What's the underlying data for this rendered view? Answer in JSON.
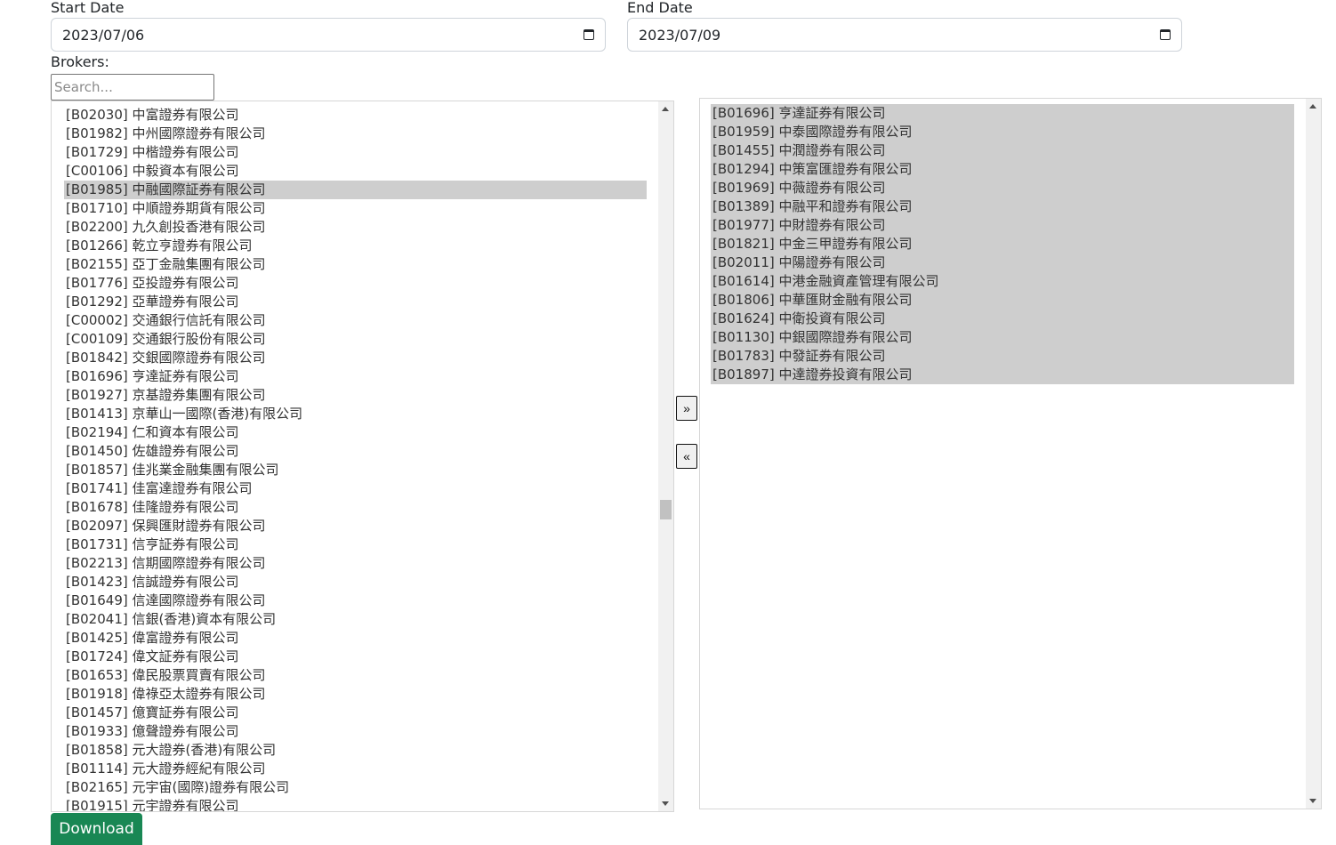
{
  "form": {
    "start_date_label": "Start Date",
    "start_date_value": "2023/07/06",
    "end_date_label": "End Date",
    "end_date_value": "2023/07/09",
    "brokers_label": "Brokers:",
    "search_placeholder": "Search..."
  },
  "available_brokers": [
    {
      "label": "[B02030] 中富證券有限公司",
      "selected": false
    },
    {
      "label": "[B01982] 中州國際證券有限公司",
      "selected": false
    },
    {
      "label": "[B01729] 中楷證券有限公司",
      "selected": false
    },
    {
      "label": "[C00106] 中毅資本有限公司",
      "selected": false
    },
    {
      "label": "[B01985] 中融國際証券有限公司",
      "selected": true
    },
    {
      "label": "[B01710] 中順證券期貨有限公司",
      "selected": false
    },
    {
      "label": "[B02200] 九久創投香港有限公司",
      "selected": false
    },
    {
      "label": "[B01266] 乾立亨證券有限公司",
      "selected": false
    },
    {
      "label": "[B02155] 亞丁金融集團有限公司",
      "selected": false
    },
    {
      "label": "[B01776] 亞投證券有限公司",
      "selected": false
    },
    {
      "label": "[B01292] 亞華證券有限公司",
      "selected": false
    },
    {
      "label": "[C00002] 交通銀行信託有限公司",
      "selected": false
    },
    {
      "label": "[C00109] 交通銀行股份有限公司",
      "selected": false
    },
    {
      "label": "[B01842] 交銀國際證券有限公司",
      "selected": false
    },
    {
      "label": "[B01696] 亨達証券有限公司",
      "selected": false
    },
    {
      "label": "[B01927] 京基證券集團有限公司",
      "selected": false
    },
    {
      "label": "[B01413] 京華山一國際(香港)有限公司",
      "selected": false
    },
    {
      "label": "[B02194] 仁和資本有限公司",
      "selected": false
    },
    {
      "label": "[B01450] 佐雄證券有限公司",
      "selected": false
    },
    {
      "label": "[B01857] 佳兆業金融集團有限公司",
      "selected": false
    },
    {
      "label": "[B01741] 佳富達證券有限公司",
      "selected": false
    },
    {
      "label": "[B01678] 佳隆證券有限公司",
      "selected": false
    },
    {
      "label": "[B02097] 保興匯財證券有限公司",
      "selected": false
    },
    {
      "label": "[B01731] 信亨証券有限公司",
      "selected": false
    },
    {
      "label": "[B02213] 信期國際證券有限公司",
      "selected": false
    },
    {
      "label": "[B01423] 信誠證券有限公司",
      "selected": false
    },
    {
      "label": "[B01649] 信達國際證券有限公司",
      "selected": false
    },
    {
      "label": "[B02041] 信銀(香港)資本有限公司",
      "selected": false
    },
    {
      "label": "[B01425] 偉富證券有限公司",
      "selected": false
    },
    {
      "label": "[B01724] 偉文証券有限公司",
      "selected": false
    },
    {
      "label": "[B01653] 偉民股票買賣有限公司",
      "selected": false
    },
    {
      "label": "[B01918] 偉祿亞太證券有限公司",
      "selected": false
    },
    {
      "label": "[B01457] 億寶証券有限公司",
      "selected": false
    },
    {
      "label": "[B01933] 億聲證券有限公司",
      "selected": false
    },
    {
      "label": "[B01858] 元大證券(香港)有限公司",
      "selected": false
    },
    {
      "label": "[B01114] 元大證券經紀有限公司",
      "selected": false
    },
    {
      "label": "[B02165] 元宇宙(國際)證券有限公司",
      "selected": false
    },
    {
      "label": "[B01915] 元宇證券有限公司",
      "selected": false
    }
  ],
  "selected_brokers": [
    {
      "label": "[B01696] 亨達証券有限公司",
      "selected": true
    },
    {
      "label": "[B01959] 中泰國際證券有限公司",
      "selected": true
    },
    {
      "label": "[B01455] 中潤證券有限公司",
      "selected": true
    },
    {
      "label": "[B01294] 中策富匯證券有限公司",
      "selected": true
    },
    {
      "label": "[B01969] 中薇證券有限公司",
      "selected": true
    },
    {
      "label": "[B01389] 中融平和證券有限公司",
      "selected": true
    },
    {
      "label": "[B01977] 中財證券有限公司",
      "selected": true
    },
    {
      "label": "[B01821] 中金三甲證券有限公司",
      "selected": true
    },
    {
      "label": "[B02011] 中陽證券有限公司",
      "selected": true
    },
    {
      "label": "[B01614] 中港金融資產管理有限公司",
      "selected": true
    },
    {
      "label": "[B01806] 中華匯財金融有限公司",
      "selected": true
    },
    {
      "label": "[B01624] 中衛投資有限公司",
      "selected": true
    },
    {
      "label": "[B01130] 中銀國際證券有限公司",
      "selected": true
    },
    {
      "label": "[B01783] 中發証券有限公司",
      "selected": true
    },
    {
      "label": "[B01897] 中達證券投資有限公司",
      "selected": true
    }
  ],
  "buttons": {
    "add_label": "»",
    "remove_label": "«",
    "download_label": "Download"
  },
  "colors": {
    "download_bg": "#198754",
    "selected_row_bg": "#cecece"
  },
  "icons": {
    "date_picker": "calendar-icon",
    "scroll_up": "arrow-up-icon",
    "scroll_down": "arrow-down-icon"
  }
}
